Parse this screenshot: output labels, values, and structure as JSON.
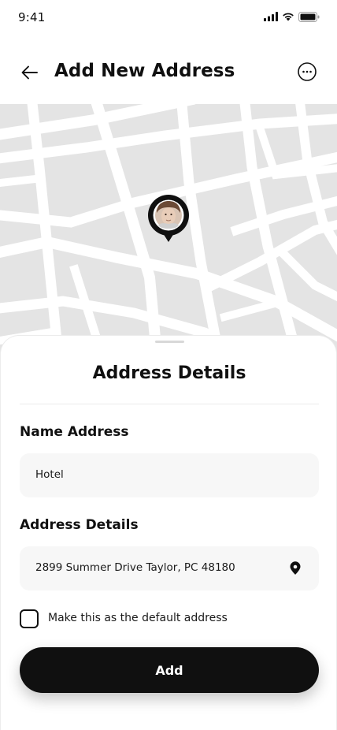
{
  "status_bar": {
    "time": "9:41"
  },
  "header": {
    "title": "Add New Address"
  },
  "sheet": {
    "title": "Address Details",
    "name_label": "Name Address",
    "name_value": "Hotel",
    "address_label": "Address Details",
    "address_value": "2899 Summer Drive Taylor, PC 48180",
    "default_checkbox_label": "Make this as the default address",
    "default_checked": false,
    "add_button_label": "Add"
  },
  "icons": {
    "back": "arrow-left-icon",
    "more": "more-horizontal-circle-icon",
    "location": "location-pin-icon",
    "signal": "cellular-signal-icon",
    "wifi": "wifi-icon",
    "battery": "battery-icon"
  },
  "colors": {
    "primary": "#101010",
    "map_block": "#e4e4e4",
    "map_road": "#ffffff",
    "field_bg": "#f7f7f7"
  }
}
